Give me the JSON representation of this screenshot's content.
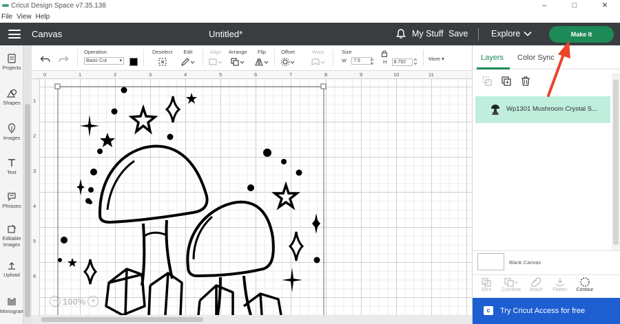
{
  "window": {
    "title": "Cricut Design Space  v7.35.138",
    "minimize": "–",
    "maximize": "□",
    "close": "✕"
  },
  "menubar": [
    "File",
    "View",
    "Help"
  ],
  "header": {
    "section": "Canvas",
    "doc_title": "Untitled*",
    "my_stuff": "My Stuff",
    "save": "Save",
    "explore": "Explore",
    "make_it": "Make It"
  },
  "sidebar": [
    {
      "label": "Projects",
      "icon": "projects-icon"
    },
    {
      "label": "Shapes",
      "icon": "shapes-icon"
    },
    {
      "label": "Images",
      "icon": "images-icon"
    },
    {
      "label": "Text",
      "icon": "text-icon"
    },
    {
      "label": "Phrases",
      "icon": "phrases-icon"
    },
    {
      "label": "Editable Images",
      "icon": "editable-images-icon"
    },
    {
      "label": "Upload",
      "icon": "upload-icon"
    },
    {
      "label": "Monogram",
      "icon": "monogram-icon"
    }
  ],
  "toolbar": {
    "operation_label": "Operation",
    "operation_value": "Basic Cut",
    "operation_color": "#000000",
    "deselect": "Deselect",
    "edit": "Edit",
    "align": "Align",
    "arrange": "Arrange",
    "flip": "Flip",
    "offset": "Offset",
    "warp": "Warp",
    "size": "Size",
    "w_label": "W",
    "w_value": "7.5",
    "h_label": "H",
    "h_value": "8.792",
    "more": "More"
  },
  "ruler": {
    "top": [
      "0",
      "1",
      "2",
      "3",
      "4",
      "5",
      "6",
      "7",
      "8",
      "9",
      "10",
      "11"
    ],
    "left": [
      "1",
      "2",
      "3",
      "4",
      "5",
      "6"
    ]
  },
  "zoom": {
    "minus": "−",
    "value": "100%",
    "plus": "+"
  },
  "panel": {
    "tabs": [
      "Layers",
      "Color Sync"
    ],
    "layer_name": "Wp1301 Mushroom Crystal S...",
    "blank_canvas": "Blank Canvas",
    "actions": [
      "Slice",
      "Combine",
      "Attach",
      "Flatten",
      "Contour"
    ],
    "access": "Try Cricut Access for free",
    "access_icon": "cricut-access-icon"
  },
  "colors": {
    "header_bg": "#3a3d40",
    "accent": "#1d8a57",
    "layer_highlight": "#bfeedd",
    "access_bg": "#1d5fd1",
    "arrow": "#e8452a"
  }
}
